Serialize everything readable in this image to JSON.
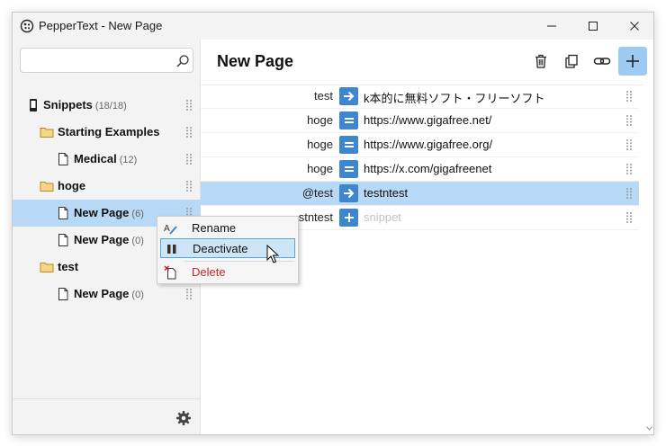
{
  "window": {
    "title": "PepperText - New Page"
  },
  "sidebar": {
    "search": {
      "value": "",
      "placeholder": ""
    },
    "items": [
      {
        "label": "Snippets",
        "count": "(18/18)",
        "icon": "device-icon"
      },
      {
        "label": "Starting Examples",
        "count": "",
        "icon": "folder-icon"
      },
      {
        "label": "Medical",
        "count": "(12)",
        "icon": "page-icon"
      },
      {
        "label": "hoge",
        "count": "",
        "icon": "folder-icon"
      },
      {
        "label": "New Page",
        "count": "(6)",
        "icon": "page-icon",
        "selected": true
      },
      {
        "label": "New Page",
        "count": "(0)",
        "icon": "page-icon"
      },
      {
        "label": "test",
        "count": "",
        "icon": "folder-icon"
      },
      {
        "label": "New Page",
        "count": "(0)",
        "icon": "page-icon"
      }
    ]
  },
  "main": {
    "title": "New Page",
    "toolbar": [
      "trash-icon",
      "copy-icon",
      "link-icon",
      "plus-icon"
    ],
    "rows": [
      {
        "trigger": "test",
        "op": "arrow-right-icon",
        "value": "k本的に無料ソフト・フリーソフト"
      },
      {
        "trigger": "hoge",
        "op": "equals-icon",
        "value": "https://www.gigafree.net/"
      },
      {
        "trigger": "hoge",
        "op": "equals-icon",
        "value": "https://www.gigafree.org/"
      },
      {
        "trigger": "hoge",
        "op": "equals-icon",
        "value": "https://x.com/gigafreenet"
      },
      {
        "trigger": "@test",
        "op": "arrow-right-icon",
        "value": "testntest",
        "selected": true
      },
      {
        "trigger": "stntest",
        "op": "plus-icon",
        "value": "snippet",
        "placeholder": true
      }
    ]
  },
  "context_menu": {
    "items": [
      {
        "label": "Rename",
        "icon": "rename-icon"
      },
      {
        "label": "Deactivate",
        "icon": "pause-icon",
        "hover": true
      },
      {
        "label": "Delete",
        "icon": "delete-page-icon",
        "danger": true
      }
    ]
  },
  "colors": {
    "accent": "#3e87d0",
    "selection": "#b8d9f5",
    "add_button": "#9ccaf0",
    "danger": "#c0272d"
  }
}
